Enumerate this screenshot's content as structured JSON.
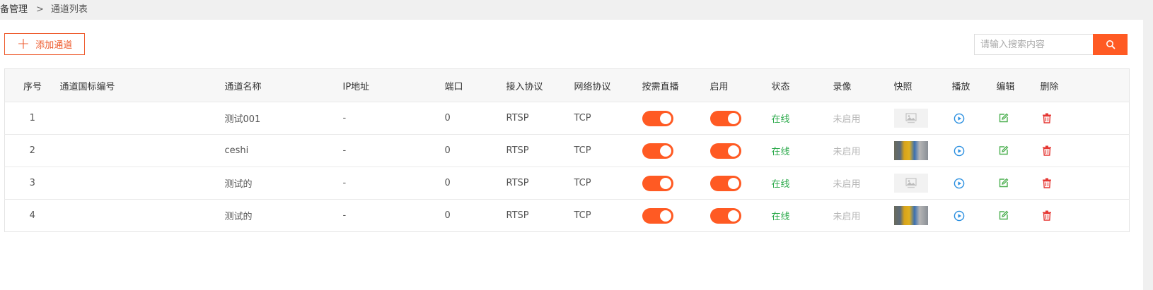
{
  "breadcrumb": {
    "parent": "备管理",
    "separator": ">",
    "current": "通道列表"
  },
  "toolbar": {
    "add_label": "添加通道",
    "search_placeholder": "请输入搜索内容"
  },
  "colors": {
    "accent": "#ff5a23",
    "online": "#2aa94a",
    "play": "#2a8fe0",
    "edit": "#4caf50",
    "delete": "#e53935"
  },
  "table": {
    "headers": [
      "序号",
      "通道国标编号",
      "通道名称",
      "IP地址",
      "端口",
      "接入协议",
      "网络协议",
      "按需直播",
      "启用",
      "状态",
      "录像",
      "快照",
      "播放",
      "编辑",
      "删除"
    ],
    "rows": [
      {
        "index": "1",
        "gb_code": "",
        "name": "测试001",
        "ip": "-",
        "port": "0",
        "protocol": "RTSP",
        "network": "TCP",
        "on_demand": true,
        "enabled": true,
        "status": "在线",
        "recording": "未启用",
        "snapshot": "placeholder-image"
      },
      {
        "index": "2",
        "gb_code": "",
        "name": "ceshi",
        "ip": "-",
        "port": "0",
        "protocol": "RTSP",
        "network": "TCP",
        "on_demand": true,
        "enabled": true,
        "status": "在线",
        "recording": "未启用",
        "snapshot": "camera-photo"
      },
      {
        "index": "3",
        "gb_code": "",
        "name": "测试的",
        "ip": "-",
        "port": "0",
        "protocol": "RTSP",
        "network": "TCP",
        "on_demand": true,
        "enabled": true,
        "status": "在线",
        "recording": "未启用",
        "snapshot": "placeholder-image"
      },
      {
        "index": "4",
        "gb_code": "",
        "name": "测试的",
        "ip": "-",
        "port": "0",
        "protocol": "RTSP",
        "network": "TCP",
        "on_demand": true,
        "enabled": true,
        "status": "在线",
        "recording": "未启用",
        "snapshot": "camera-photo"
      }
    ]
  }
}
